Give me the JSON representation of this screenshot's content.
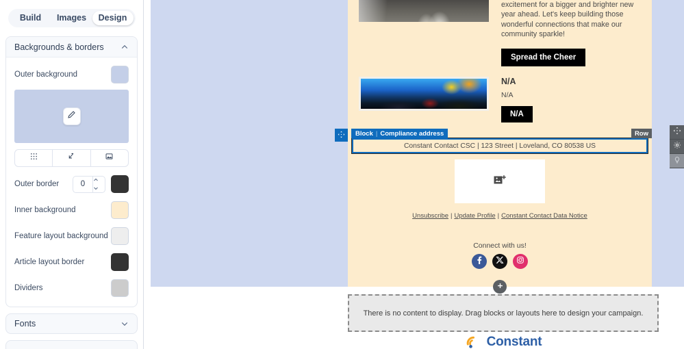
{
  "left_panel": {
    "tabs": [
      {
        "label": "Build",
        "active": false
      },
      {
        "label": "Images",
        "active": false
      },
      {
        "label": "Design",
        "active": true
      }
    ],
    "sections": [
      {
        "title": "Backgrounds & borders",
        "expanded": true
      },
      {
        "title": "Fonts",
        "expanded": false
      }
    ],
    "backgrounds": {
      "outer_background": {
        "label": "Outer background",
        "color": "#c4cfe8"
      },
      "preview_color": "#c4cfe8",
      "edit_icon": "pencil-icon",
      "mode_buttons": [
        {
          "icon": "grid-pattern-icon",
          "name": "pattern-button"
        },
        {
          "icon": "resize-diagonal-icon",
          "name": "resize-button"
        },
        {
          "icon": "image-icon",
          "name": "image-button"
        }
      ],
      "outer_border": {
        "label": "Outer border",
        "value": "0",
        "color": "#333333"
      },
      "inner_background": {
        "label": "Inner background",
        "color": "#fdeccd"
      },
      "feature_layout_background": {
        "label": "Feature layout background",
        "color": "#eeeeee"
      },
      "article_layout_border": {
        "label": "Article layout border",
        "color": "#333333"
      },
      "dividers": {
        "label": "Dividers",
        "color": "#cccccc"
      }
    }
  },
  "canvas": {
    "outer_background_color": "#ced8f0",
    "inner_background_color": "#fdeccd",
    "article_one": {
      "image_name": "road-photo",
      "body": "excitement for a bigger and brighter new year ahead. Let's keep building those wonderful connections that make our community sparkle!",
      "cta_label": "Spread the Cheer"
    },
    "article_two": {
      "image_name": "forest-painting",
      "heading": "N/A",
      "body": "N/A",
      "cta_label": "N/A"
    },
    "selected_block": {
      "tag_prefix": "Block",
      "tag_separator": "|",
      "tag_name": "Compliance address",
      "address_text": "Constant Contact CSC | 123 Street | Loveland, CO 80538 US",
      "move_icon": "move-arrows-icon",
      "highlight_color": "#0f6cbd"
    },
    "row_tag": {
      "label": "Row",
      "color": "#5b5f63"
    },
    "row_tools": [
      {
        "icon": "move-arrows-icon",
        "name": "row-move-tool",
        "disabled": false
      },
      {
        "icon": "gear-icon",
        "name": "row-settings-tool",
        "disabled": false
      },
      {
        "icon": "lightbulb-icon",
        "name": "row-ideas-tool",
        "disabled": true
      }
    ],
    "image_placeholder": {
      "icon": "add-image-icon"
    },
    "footer_links": [
      {
        "label": "Unsubscribe"
      },
      {
        "label": "Update Profile"
      },
      {
        "label": "Constant Contact Data Notice"
      }
    ],
    "footer_separator": "|",
    "connect_label": "Connect with us!",
    "socials": [
      {
        "name": "facebook-icon",
        "label": "Facebook",
        "color": "#3b5998"
      },
      {
        "name": "x-twitter-icon",
        "label": "X",
        "color": "#111111"
      },
      {
        "name": "instagram-icon",
        "label": "Instagram",
        "color": "#e1306c"
      }
    ],
    "add_block_button": {
      "icon": "plus-icon"
    },
    "empty_drop_message": "There is no content to display. Drag blocks or layouts here to design your campaign.",
    "brand": {
      "word": "Constant",
      "color": "#2d5fa6"
    }
  }
}
